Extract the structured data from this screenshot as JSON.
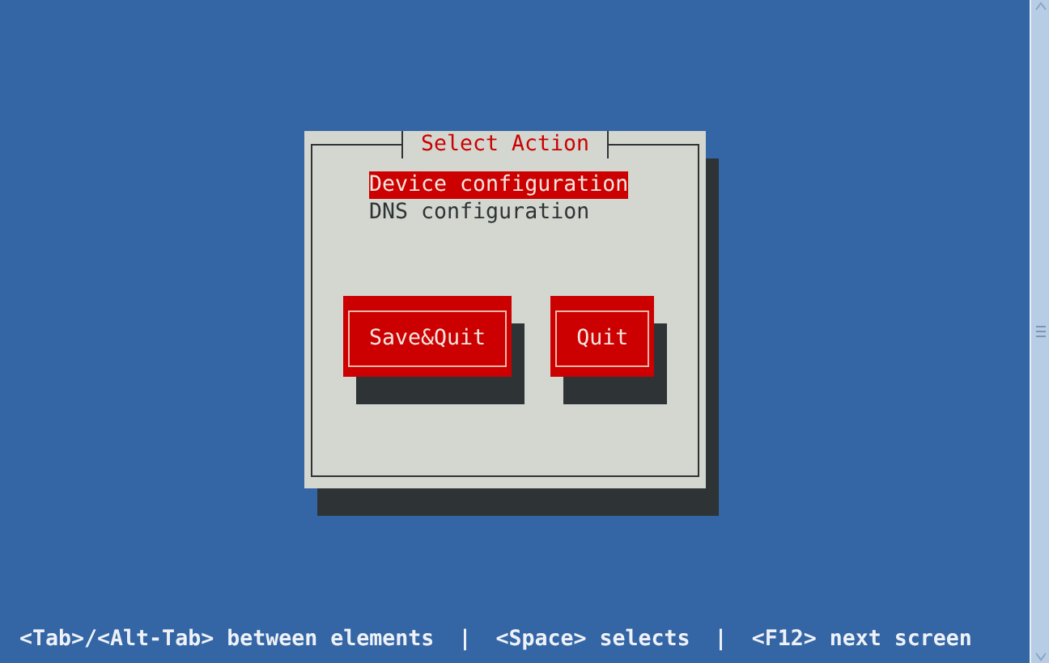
{
  "dialog": {
    "title": "Select Action",
    "items": [
      {
        "label": "Device configuration",
        "selected": true
      },
      {
        "label": "DNS configuration",
        "selected": false
      }
    ],
    "buttons": [
      {
        "label": "Save&Quit"
      },
      {
        "label": "Quit"
      }
    ]
  },
  "status_bar": {
    "items": [
      {
        "kind": "hint",
        "text": "<Tab>/<Alt-Tab> between elements"
      },
      {
        "kind": "separator",
        "text": "|"
      },
      {
        "kind": "hint",
        "text": "<Space> selects"
      },
      {
        "kind": "separator",
        "text": "|"
      },
      {
        "kind": "hint",
        "text": "<F12> next screen"
      }
    ]
  }
}
